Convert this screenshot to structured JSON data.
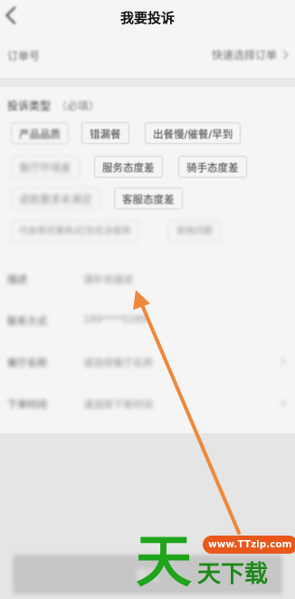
{
  "header": {
    "title": "我要投诉"
  },
  "order": {
    "label": "订单号",
    "action": "快速选择订单"
  },
  "complaint_type": {
    "title": "投诉类型",
    "required": "（必填）",
    "tags": [
      "产品品质",
      "错漏餐",
      "出餐慢/催餐/早到",
      "餐厅环境差",
      "服务态度差",
      "骑手态度差",
      "退款要求未满足",
      "客服态度差",
      "代金券优惠券/红包无法使用",
      "其他问题"
    ]
  },
  "form": {
    "rows": [
      {
        "label": "描述",
        "value": "请补充描述"
      },
      {
        "label": "联系方式",
        "value": "189****5289"
      },
      {
        "label": "餐厅名称",
        "value": "请选择餐厅名称"
      },
      {
        "label": "下单时间",
        "value": "请选择下单时间"
      }
    ]
  },
  "submit": {
    "label": "提交"
  },
  "watermark": {
    "big": "天",
    "url": "www.TTzip.com",
    "text": "天下载"
  },
  "colors": {
    "arrow": "#f0883a",
    "logo_green": "#1ea51a",
    "logo_orange": "#e8581b"
  }
}
